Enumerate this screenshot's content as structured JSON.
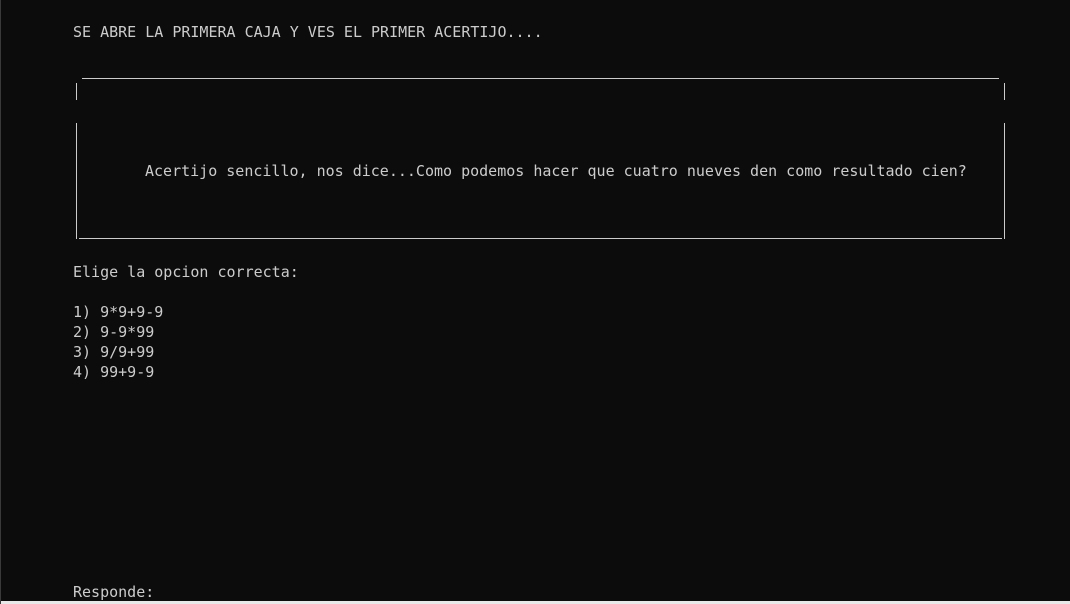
{
  "console": {
    "intro": "SE ABRE LA PRIMERA CAJA Y VES EL PRIMER ACERTIJO....",
    "riddle": "Acertijo sencillo, nos dice...Como podemos hacer que cuatro nueves den como resultado cien?",
    "choose_label": "Elige la opcion correcta:",
    "options": [
      "1) 9*9+9-9",
      "2) 9-9*99",
      "3) 9/9+99",
      "4) 99+9-9"
    ],
    "prompt": "Responde:"
  },
  "colors": {
    "background": "#0c0c0c",
    "text": "#cccccc"
  }
}
